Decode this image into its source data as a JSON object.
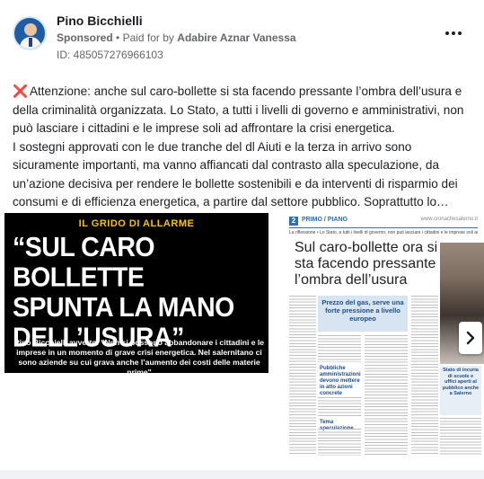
{
  "ad": {
    "page_name": "Pino Bicchielli",
    "sponsored_label": "Sponsored",
    "paid_for_prefix": "Paid for by",
    "paid_for_by": "Adabire Aznar Vanessa",
    "id_label": "ID: 485057276966103",
    "body_paragraphs": [
      "Attenzione: anche sul caro-bollette si sta facendo pressante l’ombra dell’usura e della criminalità organizzata. Lo Stato, a tutti i livelli di governo e amministrativi, non può lasciare i cittadini e le imprese soli ad affrontare la crisi energetica.",
      "I sostegni approvati con le due tranche del dl Aiuti e la terza in arrivo sono sicuramente importanti, ma vanno affiancati dal contrasto alla speculazione, da un’azione decisiva per rendere le bollette sostenibili e da interventi di risparmio dei consumi e di efficienza energetica, a partire dal settore pubblico. Soprattutto lo…"
    ],
    "lead_icon": "cross-mark-icon"
  },
  "carousel": {
    "slide1": {
      "kicker": "IL GRIDO DI ALLARME",
      "title_line1": "“SUL CARO BOLLETTE",
      "title_line2": "SPUNTA LA MANO",
      "title_line3": "DELL’USURA”",
      "description": "Pino Bicchielli avverte: \"Non si possono abbandonare i cittadini e le imprese in un momento di grave crisi energetica. Nel salernitano ci sono aziende su cui grava anche l’aumento dei costi delle materie prime\""
    },
    "slide2": {
      "page_number": "2",
      "section": "PRIMO / PIANO",
      "website": "www.cronachesalerno.it",
      "lede": "La riflessione • Lo Stato, a tutti i livelli di governo, non può lasciare i cittadini e le imprese soli ad affro",
      "headline": "Sul caro-bollette ora si sta facendo pressante l’ombra dell’usura",
      "box_text": "Prezzo del gas, serve una forte pressione a livello europeo",
      "subhead_1": "Pubbliche amministrazioni devono mettere in atto azioni concrete",
      "subhead_2": "Tema speculazione",
      "side_box": "Stato di incuria di scuole e uffici aperti al pubblico anche a Salerno"
    },
    "next_icon": "chevron-right-icon"
  },
  "colors": {
    "name_text": "#1c1e21",
    "meta_text": "#65676b",
    "accent_red": "#e0245e",
    "kicker_yellow": "#f3c200",
    "newspaper_blue": "#2e6fb7"
  }
}
